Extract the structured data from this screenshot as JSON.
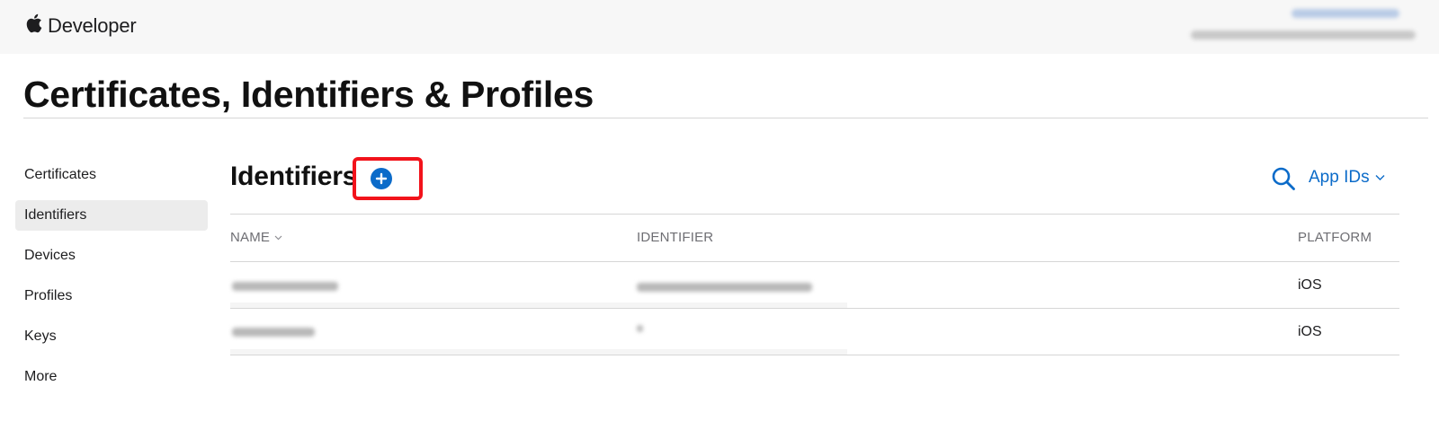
{
  "header": {
    "brand_label": "Developer",
    "icon": "apple-logo-icon"
  },
  "page": {
    "title": "Certificates, Identifiers & Profiles"
  },
  "sidebar": {
    "items": [
      {
        "label": "Certificates",
        "active": false
      },
      {
        "label": "Identifiers",
        "active": true
      },
      {
        "label": "Devices",
        "active": false
      },
      {
        "label": "Profiles",
        "active": false
      },
      {
        "label": "Keys",
        "active": false
      },
      {
        "label": "More",
        "active": false
      }
    ]
  },
  "main": {
    "heading": "Identifiers",
    "add_icon": "plus-circle-icon",
    "search_icon": "search-icon",
    "filter": {
      "selected": "App IDs",
      "icon": "chevron-down-icon"
    },
    "accent_color": "#0b6bc9",
    "highlight_color": "#f2131b"
  },
  "table": {
    "columns": {
      "name": "NAME",
      "identifier": "IDENTIFIER",
      "platform": "PLATFORM"
    },
    "rows": [
      {
        "platform": "iOS"
      },
      {
        "platform": "iOS"
      }
    ]
  }
}
